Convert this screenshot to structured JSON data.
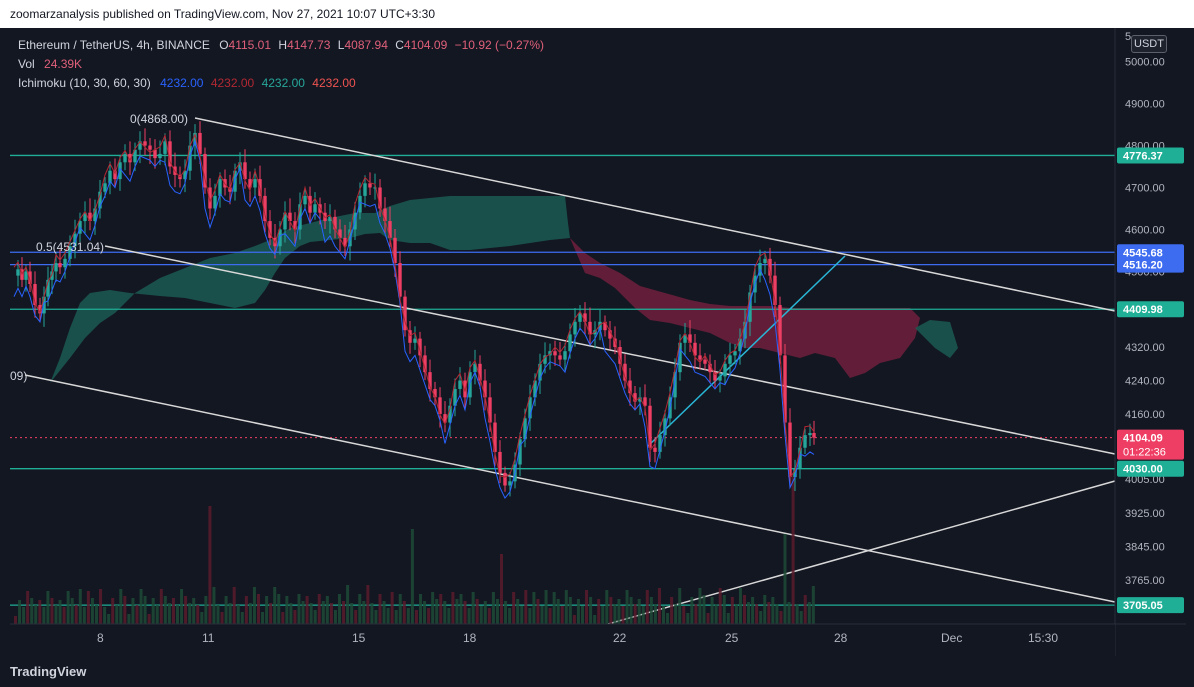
{
  "header": {
    "published": "zoomarzanalysis published on TradingView.com, Nov 27, 2021 10:07 UTC+3:30"
  },
  "legend": {
    "symbol": "Ethereum / TetherUS, 4h, BINANCE",
    "open_label": "O",
    "open": "4115.01",
    "high_label": "H",
    "high": "4147.73",
    "low_label": "L",
    "low": "4087.94",
    "close_label": "C",
    "close": "4104.09",
    "change": "−10.92 (−0.27%)",
    "vol_label": "Vol",
    "vol": "24.39K",
    "ichimoku_label": "Ichimoku (10, 30, 60, 30)",
    "ichi_v1": "4232.00",
    "ichi_v2": "4232.00",
    "ichi_v3": "4232.00",
    "ichi_v4": "4232.00"
  },
  "currency_badge": "USDT",
  "footer": {
    "logo": "TradingView"
  },
  "colors": {
    "background": "#131722",
    "up": "#26a69a",
    "down": "#ef3e64",
    "hline": "#1fae96",
    "blue_line": "#3d6cf0",
    "cloud_bull": "#1b5a52",
    "cloud_bear": "#6b1f3b",
    "trendline": "#d8d8d8",
    "cyan_line": "#29b6d6"
  },
  "chart_data": {
    "type": "candlestick",
    "x_tick_labels": [
      "8",
      "11",
      "15",
      "18",
      "22",
      "25",
      "28",
      "Dec",
      "15:30"
    ],
    "y_tick_labels": [
      "5000.00",
      "4900.00",
      "4800.00",
      "4700.00",
      "4600.00",
      "4500.00",
      "4320.00",
      "4240.00",
      "4160.00",
      "4005.00",
      "3925.00",
      "3845.00",
      "3765.00"
    ],
    "ylim": [
      3660,
      5080
    ],
    "price_labels": [
      {
        "value": 4776.37,
        "text": "4776.37",
        "color": "#1fae96"
      },
      {
        "value": 4545.68,
        "text": "4545.68",
        "color": "#3d6cf0"
      },
      {
        "value": 4516.2,
        "text": "4516.20",
        "color": "#3d6cf0"
      },
      {
        "value": 4409.98,
        "text": "4409.98",
        "color": "#1fae96"
      },
      {
        "value": 4104.09,
        "text": "4104.09",
        "color": "#ef3e64"
      },
      {
        "value": 4030.0,
        "text": "4030.00",
        "color": "#1fae96"
      },
      {
        "value": 3705.05,
        "text": "3705.05",
        "color": "#1fae96"
      }
    ],
    "countdown": "01:22:36",
    "annotations": [
      {
        "text": "0(4868.00)"
      },
      {
        "text": "0.5(4531.04)"
      },
      {
        "text": "09)"
      }
    ],
    "horizontal_levels": [
      4776.37,
      4545.68,
      4516.2,
      4409.98,
      4030.0,
      3705.05
    ],
    "last_price": 4104.09
  }
}
